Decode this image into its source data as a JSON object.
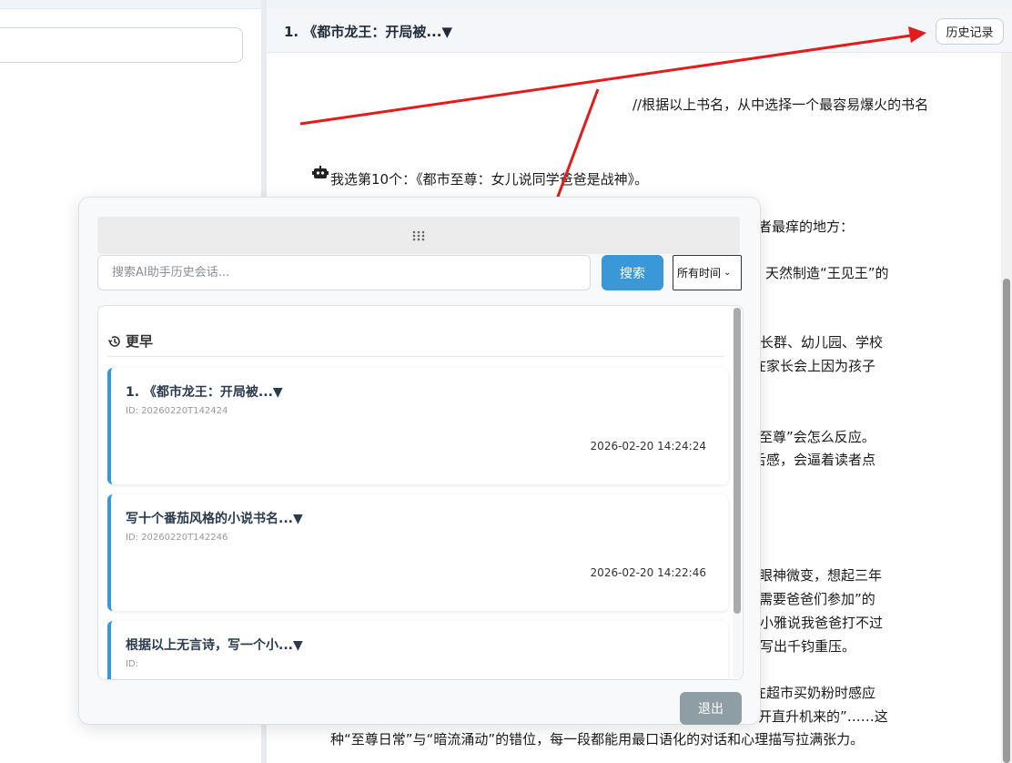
{
  "chat": {
    "title": "1. 《都市龙王：开局被...▼",
    "history_button": "历史记录",
    "lines": [
      "//根据以上书名，从中选择一个最容易爆火的书名",
      "我选第10个：《都市至尊：女儿说同学爸爸是战神》。",
      "者最痒的地方：",
      "天然制造“王见王”的",
      "长群、幼儿园、学校",
      "在家长会上因为孩子",
      "市至尊”会怎么反应。",
      "舌感，会逼着读者点",
      "的眼神微变，想起三年",
      "的需要爸爸们参加”的",
      "小雅说我爸爸打不过",
      "写出千钧重压。",
      "在超市买奶粉时感应",
      "开直升机来的”……这",
      "种“至尊日常”与“暗流涌动”的错位，每一段都能用最口语化的对话和心理描写拉满张力。"
    ]
  },
  "history_modal": {
    "search_placeholder": "搜索AI助手历史会话...",
    "search_button": "搜索",
    "time_filter": "所有时间",
    "section_label": "更早",
    "items": [
      {
        "title": "1. 《都市龙王：开局被...▼",
        "id": "ID: 20260220T142424",
        "time": "2026-02-20 14:24:24"
      },
      {
        "title": "写十个番茄风格的小说书名...▼",
        "id": "ID: 20260220T142246",
        "time": "2026-02-20 14:22:46"
      },
      {
        "title": "根据以上无言诗，写一个小...▼",
        "id": "ID:",
        "time": ""
      }
    ],
    "exit_button": "退出"
  },
  "colors": {
    "accent": "#3a97d8",
    "exit_button": "#8f9ea4",
    "annotation_arrow": "#e21b1b"
  },
  "icons": {
    "drag": "drag-grip-icon",
    "history": "history-clock-icon",
    "assistant": "robot-icon",
    "dropdown": "chevron-down-icon"
  }
}
